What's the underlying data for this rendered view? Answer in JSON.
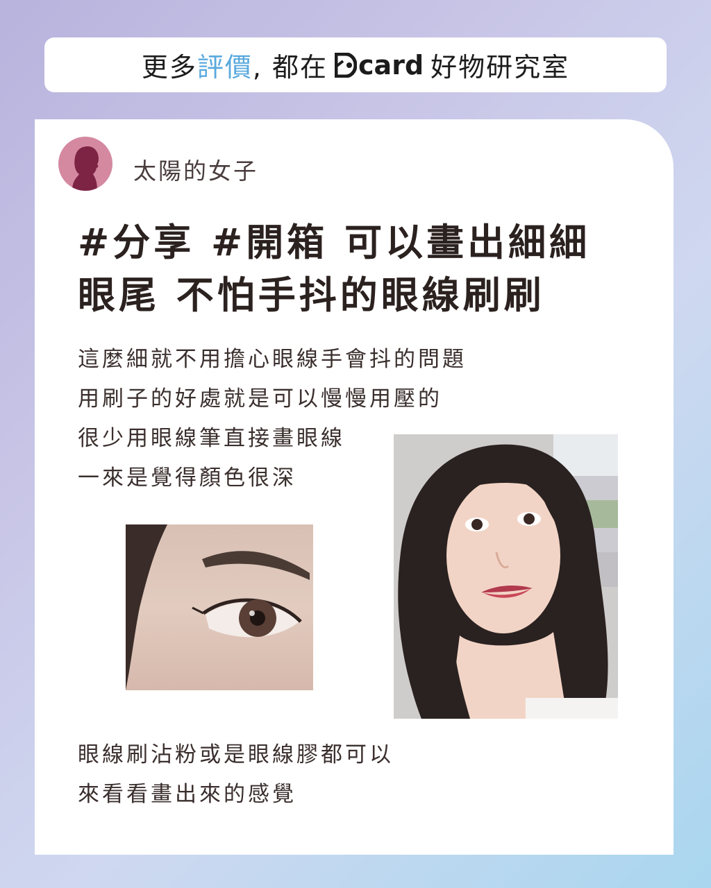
{
  "banner": {
    "prefix": "更多",
    "accent": "評價",
    "middle": ", 都在",
    "logo_text": "card",
    "suffix": "好物研究室",
    "accent_color": "#5aa9de"
  },
  "post": {
    "author": "太陽的女子",
    "title_lines": [
      "#分享 #開箱 可以畫出細細",
      "眼尾 不怕手抖的眼線刷刷"
    ],
    "body_lines_1": [
      "這麼細就不用擔心眼線手會抖的問題",
      "用刷子的好處就是可以慢慢用壓的",
      "很少用眼線筆直接畫眼線",
      "一來是覺得顏色很深"
    ],
    "body_lines_2": [
      "眼線刷沾粉或是眼線膠都可以",
      "來看看畫出來的感覺"
    ],
    "avatar_color": "#d489a1"
  }
}
